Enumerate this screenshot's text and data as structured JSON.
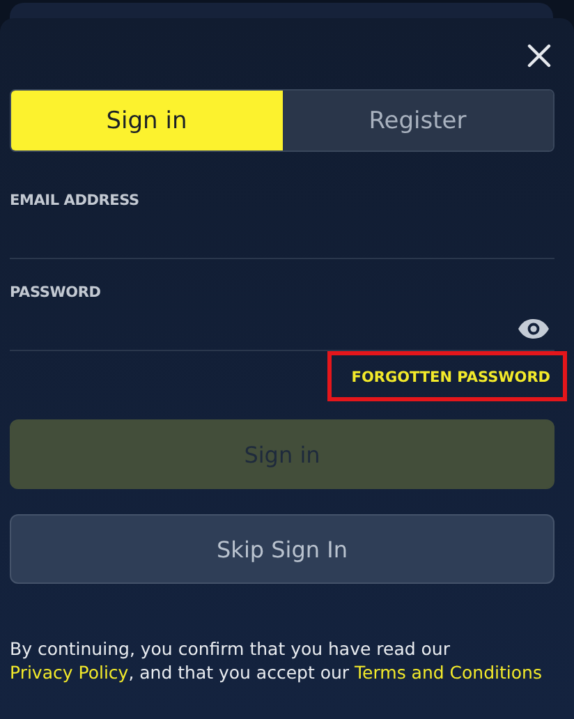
{
  "tabs": [
    {
      "label": "Sign in",
      "selected": true
    },
    {
      "label": "Register",
      "selected": false
    }
  ],
  "fields": [
    {
      "label": "EMAIL ADDRESS",
      "kind": "text"
    },
    {
      "label": "PASSWORD",
      "kind": "password"
    }
  ],
  "forgot_link": {
    "label": "FORGOTTEN PASSWORD",
    "highlighted": true
  },
  "buttons": [
    {
      "label": "Sign in",
      "kind": "primary",
      "disabled": true
    },
    {
      "label": "Skip Sign In",
      "kind": "secondary",
      "disabled": false
    }
  ],
  "footer": [
    {
      "kind": "text",
      "text": "By continuing, you confirm that you have read our "
    },
    {
      "kind": "link",
      "text": "Privacy Policy"
    },
    {
      "kind": "text",
      "text": ", and that you accept our "
    },
    {
      "kind": "link",
      "text": "Terms and Conditions"
    }
  ]
}
